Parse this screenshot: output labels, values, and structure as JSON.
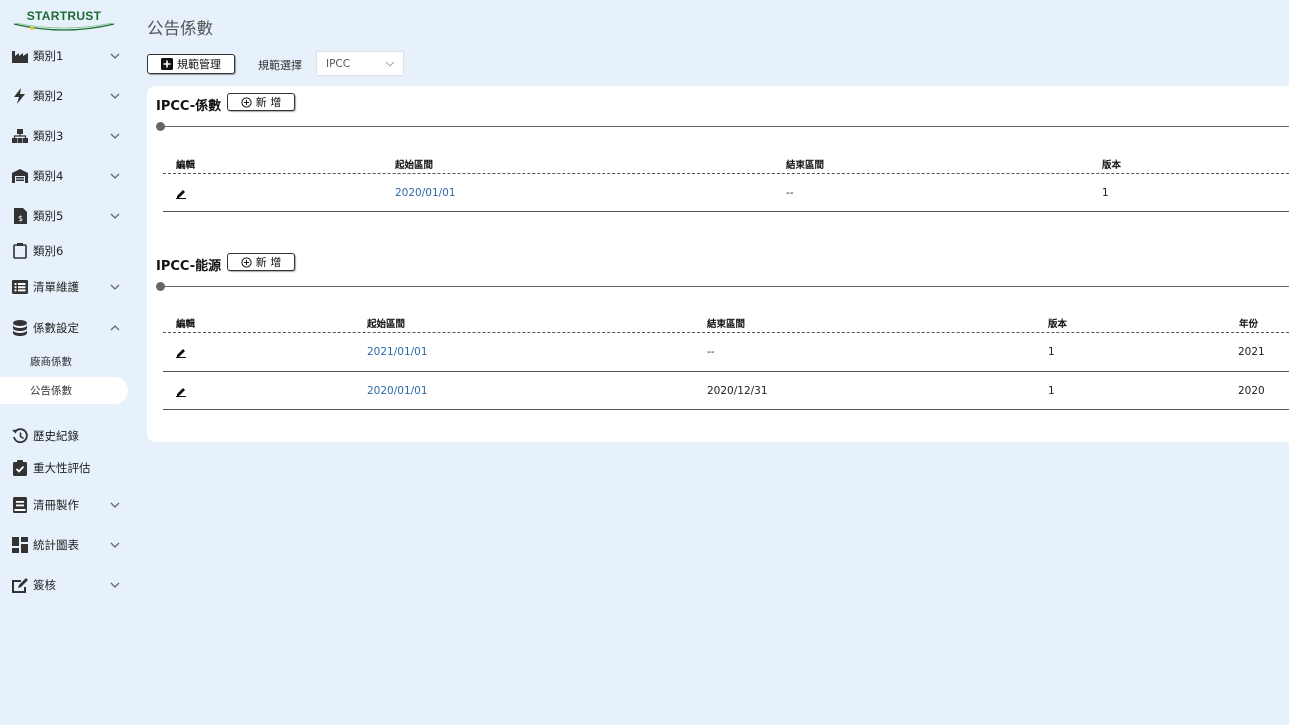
{
  "logo": {
    "text": "STARTRUST"
  },
  "sidebar": {
    "items": [
      {
        "label": "類別1",
        "icon": "factory-icon",
        "chevron": true
      },
      {
        "label": "類別2",
        "icon": "lightning-icon",
        "chevron": true
      },
      {
        "label": "類別3",
        "icon": "network-icon",
        "chevron": true
      },
      {
        "label": "類別4",
        "icon": "warehouse-icon",
        "chevron": true
      },
      {
        "label": "類別5",
        "icon": "document-dollar-icon",
        "chevron": true
      },
      {
        "label": "類別6",
        "icon": "clipboard-icon",
        "chevron": false
      },
      {
        "label": "清單維護",
        "icon": "list-icon",
        "chevron": true
      },
      {
        "label": "係數設定",
        "icon": "database-icon",
        "chevron": true,
        "expanded": true
      },
      {
        "label": "歷史紀錄",
        "icon": "history-icon",
        "chevron": false
      },
      {
        "label": "重大性評估",
        "icon": "clipboard-check-icon",
        "chevron": false
      },
      {
        "label": "清冊製作",
        "icon": "book-icon",
        "chevron": true
      },
      {
        "label": "統計圖表",
        "icon": "dashboard-icon",
        "chevron": true
      },
      {
        "label": "簽核",
        "icon": "sign-icon",
        "chevron": true
      }
    ],
    "subitems": [
      {
        "label": "廠商係數",
        "active": false
      },
      {
        "label": "公告係數",
        "active": true
      }
    ]
  },
  "page": {
    "title": "公告係數"
  },
  "toolbar": {
    "manage_label": "規範管理",
    "select_label": "規範選擇",
    "select_value": "IPCC"
  },
  "sections": [
    {
      "title": "IPCC-係數",
      "add_label": "新 增",
      "headers": [
        "編輯",
        "起始區間",
        "結束區間",
        "版本"
      ],
      "rows": [
        [
          "2020/01/01",
          "--",
          "1"
        ]
      ]
    },
    {
      "title": "IPCC-能源",
      "add_label": "新 增",
      "headers": [
        "編輯",
        "起始區間",
        "結束區間",
        "版本",
        "年份"
      ],
      "rows": [
        [
          "2021/01/01",
          "--",
          "1",
          "2021"
        ],
        [
          "2020/01/01",
          "2020/12/31",
          "1",
          "2020"
        ]
      ]
    }
  ],
  "colors": {
    "background": "#e6f1fb",
    "link": "#2d6aa8",
    "logo": "#1d6b34",
    "active_sub": "#ffffff"
  }
}
